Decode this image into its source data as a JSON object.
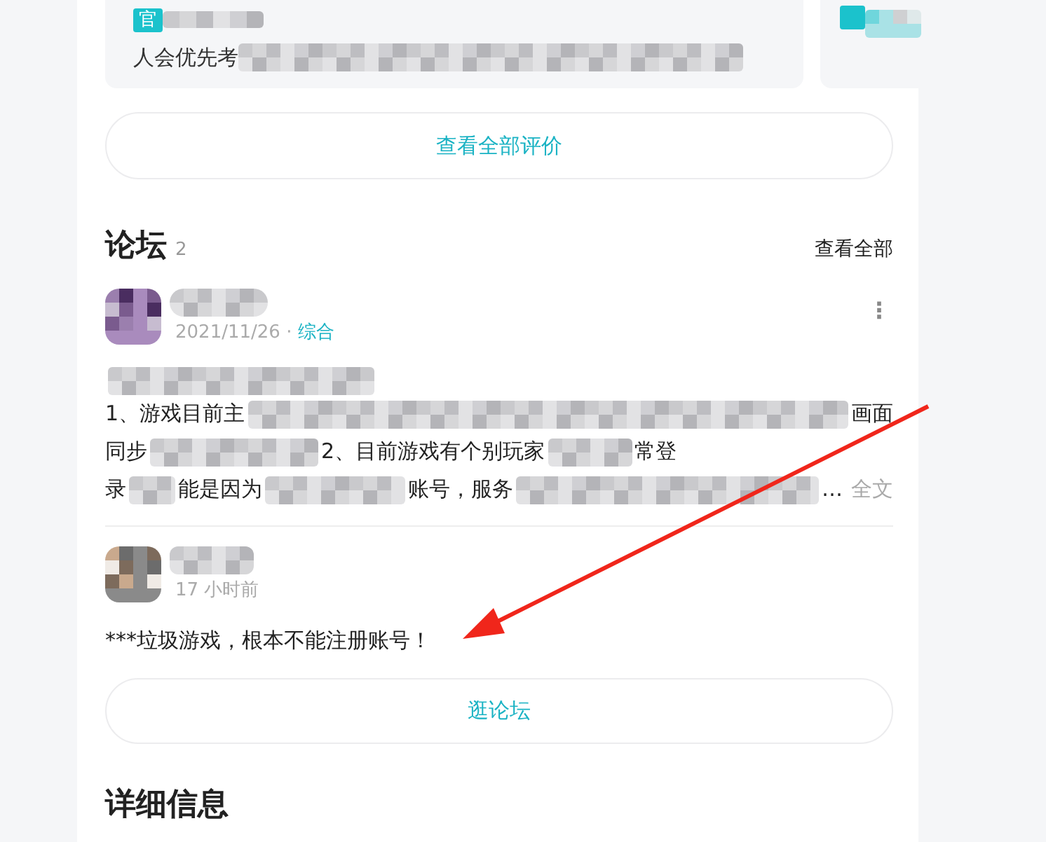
{
  "review_cards": [
    {
      "kind": "review",
      "badge": "官",
      "text": "人会优先考"
    },
    {
      "kind": "teaser"
    }
  ],
  "all_reviews_button": "查看全部评价",
  "forum": {
    "title": "论坛",
    "count": "2",
    "view_all": "查看全部",
    "post": {
      "date": "2021/11/26",
      "separator": "·",
      "category": "综合",
      "more": "⋮",
      "lines": [
        [
          {
            "text": "1、游戏目前主"
          },
          {
            "kind": "mosaic"
          },
          {
            "text": "画面"
          }
        ],
        [
          {
            "text": "同步"
          },
          {
            "kind": "mosaic"
          },
          {
            "text": "2、目前游戏有个别玩家"
          },
          {
            "kind": "mosaic"
          },
          {
            "text": "常登"
          }
        ],
        [
          {
            "text": "录"
          },
          {
            "kind": "mosaic"
          },
          {
            "text": "能是因为"
          },
          {
            "kind": "mosaic"
          },
          {
            "text": "账号，服务"
          },
          {
            "kind": "mosaic"
          },
          {
            "text": "…"
          },
          {
            "text": "全文",
            "kind": "more"
          }
        ]
      ]
    },
    "comment": {
      "time": "17 小时前",
      "text": "***垃圾游戏，根本不能注册账号！"
    },
    "browse_button": "逛论坛"
  },
  "details_title": "详细信息"
}
